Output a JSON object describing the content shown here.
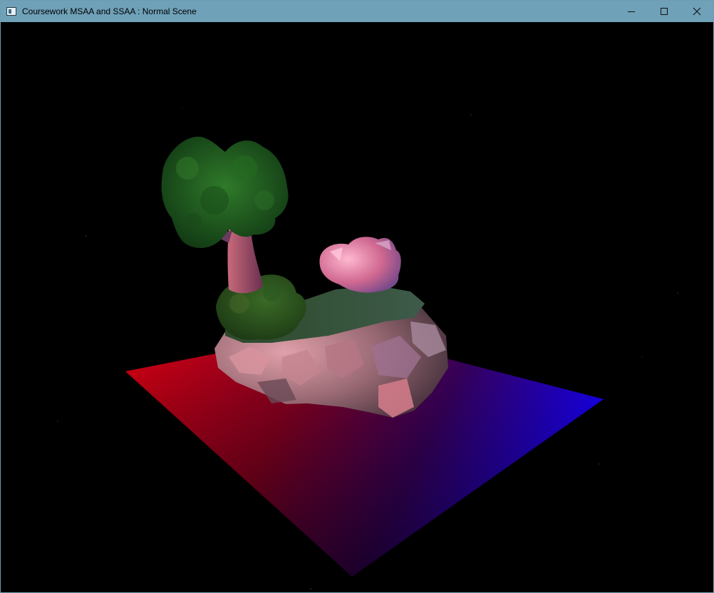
{
  "window": {
    "title": "Coursework MSAA and SSAA : Normal Scene",
    "controls": {
      "minimize": "minimize-icon",
      "maximize": "maximize-icon",
      "close": "close-icon"
    }
  },
  "scene": {
    "background": "#000000",
    "plane_colors": [
      "#e00010",
      "#7a0020",
      "#2a0070",
      "#1a00ff"
    ],
    "tree_foliage_color": "#1f5a1f",
    "trunk_color": "#b85a6a",
    "rock_color": "#c87a86",
    "crystal_color": "#e890b0"
  }
}
